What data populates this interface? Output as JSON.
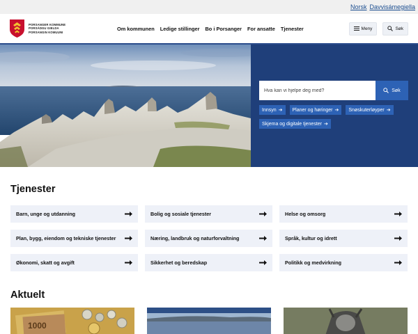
{
  "lang": {
    "norsk": "Norsk",
    "sami": "Davvisámegiella"
  },
  "logo": {
    "line1": "PORSANGER KOMMUNE",
    "line2": "PORSÁŊGU GIELDA",
    "line3": "PORSANGIN KOMUUNI"
  },
  "nav": [
    "Om kommunen",
    "Ledige stillinger",
    "Bo i Porsanger",
    "For ansatte",
    "Tjenester"
  ],
  "header_buttons": {
    "menu": "Meny",
    "search": "Søk"
  },
  "hero": {
    "search_placeholder": "Hva kan vi hjelpe deg med?",
    "search_button": "Søk",
    "chips": [
      "Innsyn",
      "Planer og høringer",
      "Snøskuterløyper",
      "Skjema og digitale tjenester"
    ]
  },
  "services": {
    "title": "Tjenester",
    "items": [
      "Barn, unge og utdanning",
      "Bolig og sosiale tjenester",
      "Helse og omsorg",
      "Plan, bygg, eiendom og tekniske tjenester",
      "Næring, landbruk og naturforvaltning",
      "Språk, kultur og idrett",
      "Økonomi, skatt og avgift",
      "Sikkerhet og beredskap",
      "Politikk og medvirkning"
    ]
  },
  "news": {
    "title": "Aktuelt"
  },
  "colors": {
    "brand_blue": "#1f3f7a",
    "accent_blue": "#2d62b5",
    "card_bg": "#eef1f8",
    "crest_red": "#c8102e"
  },
  "icons": {
    "menu": "hamburger-icon",
    "search": "magnifier-icon",
    "arrow": "arrow-right-icon"
  }
}
